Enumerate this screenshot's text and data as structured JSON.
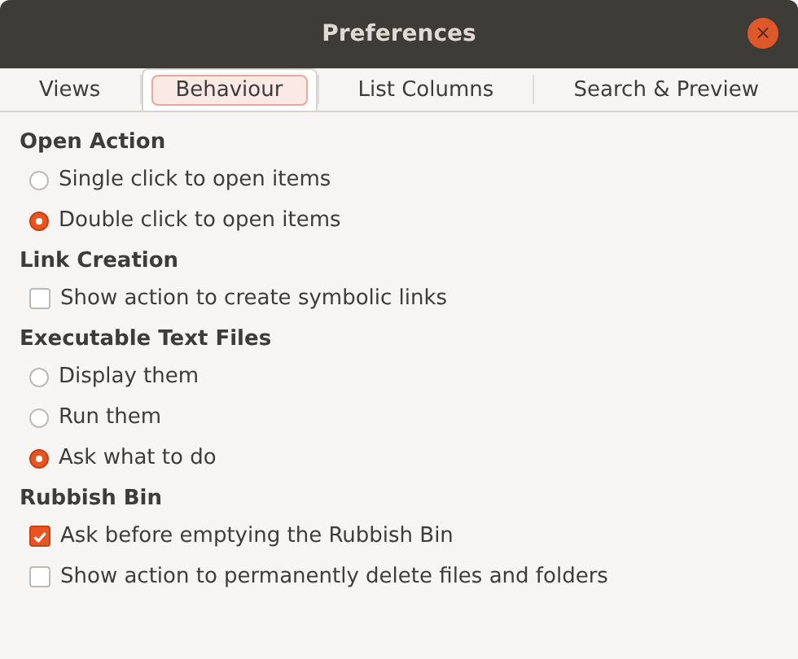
{
  "window": {
    "title": "Preferences",
    "close_label": "×"
  },
  "tabs": [
    {
      "label": "Views",
      "selected": false
    },
    {
      "label": "Behaviour",
      "selected": true
    },
    {
      "label": "List Columns",
      "selected": false
    },
    {
      "label": "Search & Preview",
      "selected": false
    }
  ],
  "sections": [
    {
      "title": "Open Action",
      "options": [
        {
          "kind": "radio",
          "label": "Single click to open items",
          "checked": false
        },
        {
          "kind": "radio",
          "label": "Double click to open items",
          "checked": true
        }
      ]
    },
    {
      "title": "Link Creation",
      "options": [
        {
          "kind": "checkbox",
          "label": "Show action to create symbolic links",
          "checked": false
        }
      ]
    },
    {
      "title": "Executable Text Files",
      "options": [
        {
          "kind": "radio",
          "label": "Display them",
          "checked": false
        },
        {
          "kind": "radio",
          "label": "Run them",
          "checked": false
        },
        {
          "kind": "radio",
          "label": "Ask what to do",
          "checked": true
        }
      ]
    },
    {
      "title": "Rubbish Bin",
      "options": [
        {
          "kind": "checkbox",
          "label": "Ask before emptying the Rubbish Bin",
          "checked": true
        },
        {
          "kind": "checkbox",
          "label": "Show action to permanently delete files and folders",
          "checked": false
        }
      ]
    }
  ]
}
